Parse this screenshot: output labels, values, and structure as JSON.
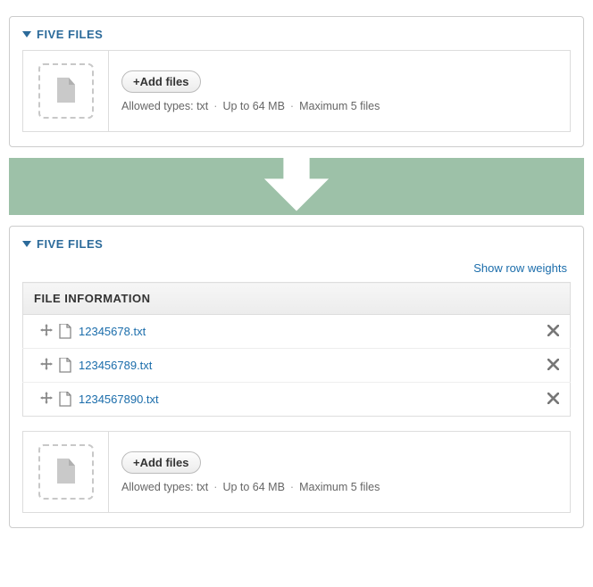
{
  "panel1": {
    "title": "FIVE FILES",
    "add_label": "+Add files",
    "hint_types": "Allowed types: txt",
    "hint_size": "Up to 64 MB",
    "hint_count": "Maximum 5 files"
  },
  "panel2": {
    "title": "FIVE FILES",
    "show_weights": "Show row weights",
    "table_header": "FILE INFORMATION",
    "files": [
      {
        "name": "12345678.txt"
      },
      {
        "name": "123456789.txt"
      },
      {
        "name": "1234567890.txt"
      }
    ],
    "add_label": "+Add files",
    "hint_types": "Allowed types: txt",
    "hint_size": "Up to 64 MB",
    "hint_count": "Maximum 5 files"
  }
}
